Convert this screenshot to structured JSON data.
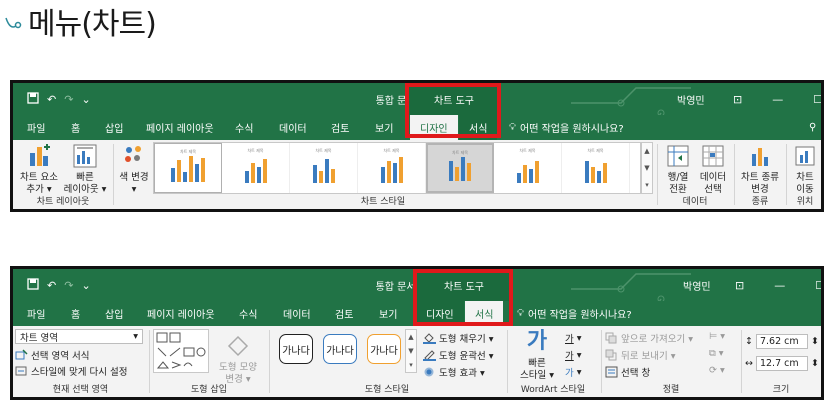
{
  "slide": {
    "title": "메뉴(차트)"
  },
  "top": {
    "qat": {
      "undo": "↶",
      "redo": "↷",
      "more": "⌄"
    },
    "doc_title": "통합 문서1 - Excel",
    "context_tool": "차트 도구",
    "user": "박영민",
    "tabs": [
      "파일",
      "홈",
      "삽입",
      "페이지 레이아웃",
      "수식",
      "데이터",
      "검토",
      "보기"
    ],
    "ctx_tabs": [
      "디자인",
      "서식"
    ],
    "tell_me": "어떤 작업을 원하시나요?",
    "buttons": {
      "add_element": [
        "차트 요소",
        "추가 ▾"
      ],
      "quick_layout": [
        "빠른",
        "레이아웃 ▾"
      ],
      "change_color": [
        "색 변경",
        "▾"
      ],
      "switch_row_col": [
        "행/열",
        "전환"
      ],
      "select_data": [
        "데이터",
        "선택"
      ],
      "change_type": [
        "차트 종류",
        "변경"
      ],
      "move_chart": [
        "차트",
        "이동"
      ]
    },
    "groups": {
      "layouts": "차트 레이아웃",
      "styles": "차트 스타일",
      "data": "데이터",
      "type": "종류",
      "location": "위치"
    },
    "thumb_title": "차트 제목",
    "accent": "#217346"
  },
  "bottom": {
    "doc_title": "통합 문서1 - Excel",
    "context_tool": "차트 도구",
    "user": "박영민",
    "tabs": [
      "파일",
      "홈",
      "삽입",
      "페이지 레이아웃",
      "수식",
      "데이터",
      "검토",
      "보기"
    ],
    "ctx_tabs": [
      "디자인",
      "서식"
    ],
    "tell_me": "어떤 작업을 원하시나요?",
    "selection": {
      "dropdown": "차트 영역",
      "format_selection": "선택 영역 서식",
      "reset_style": "스타일에 맞게 다시 설정",
      "label": "현재 선택 영역"
    },
    "insert_shapes": {
      "change_shape": [
        "도형 모양",
        "변경 ▾"
      ],
      "label": "도형 삽입"
    },
    "shape_styles": {
      "preset": "가나다",
      "fill": "도형 채우기 ▾",
      "outline": "도형 윤곽선 ▾",
      "effects": "도형 효과 ▾",
      "label": "도형 스타일"
    },
    "wordart": {
      "quick_styles": [
        "빠른",
        "스타일 ▾"
      ],
      "label": "WordArt 스타일"
    },
    "arrange": {
      "bring_forward": "앞으로 가져오기 ▾",
      "send_backward": "뒤로 보내기 ▾",
      "selection_pane": "선택 창",
      "label": "정렬"
    },
    "size": {
      "height": "7.62 cm",
      "width": "12.7 cm",
      "label": "크기"
    }
  }
}
